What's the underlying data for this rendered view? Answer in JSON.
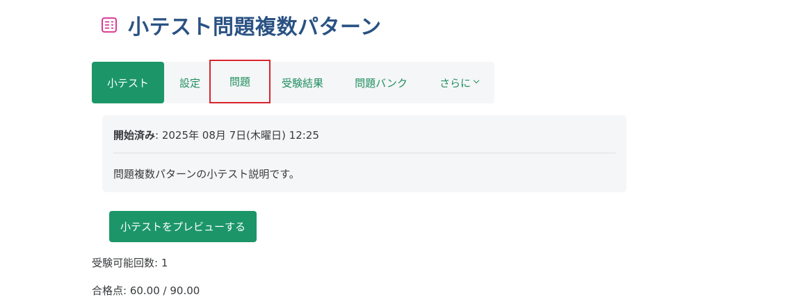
{
  "header": {
    "title": "小テスト問題複数パターン",
    "icon": "quiz-icon",
    "icon_color": "#d6268a"
  },
  "tabs": [
    {
      "label": "小テスト",
      "active": true
    },
    {
      "label": "設定"
    },
    {
      "label": "問題",
      "highlighted": true
    },
    {
      "label": "受験結果"
    },
    {
      "label": "問題バンク"
    },
    {
      "label": "さらに",
      "icon": "chevron-down-icon"
    }
  ],
  "info": {
    "opened_label": "開始済み",
    "opened_sep": ": ",
    "opened_value": "2025年 08月 7日(木曜日) 12:25",
    "description": "問題複数パターンの小テスト説明です。"
  },
  "preview_button": "小テストをプレビューする",
  "stats": {
    "attempts": "受験可能回数: 1",
    "grade_to_pass": "合格点: 60.00 / 90.00"
  },
  "colors": {
    "accent": "#1c9669",
    "title": "#2a5283",
    "highlight_border": "#d9232b"
  }
}
